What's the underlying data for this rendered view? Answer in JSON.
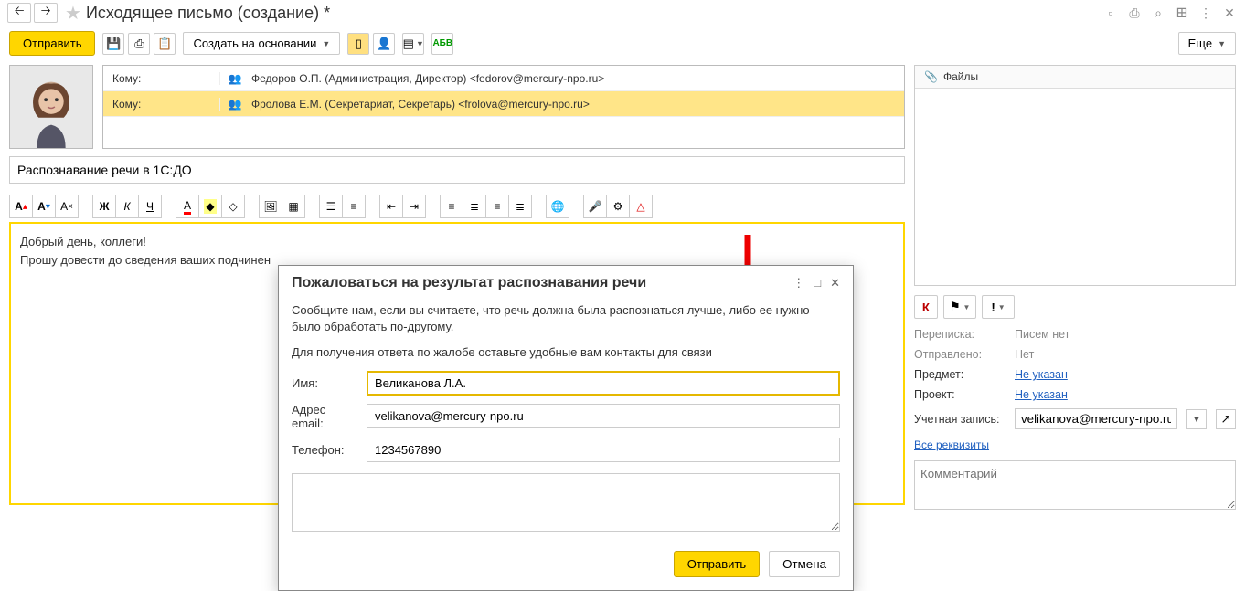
{
  "header": {
    "title": "Исходящее письмо (создание) *"
  },
  "toolbar": {
    "send": "Отправить",
    "create_based": "Создать на основании",
    "more": "Еще"
  },
  "recipients": {
    "label": "Кому:",
    "rows": [
      "Федоров О.П. (Администрация, Директор) <fedorov@mercury-npo.ru>",
      "Фролова Е.М. (Секретариат, Секретарь) <frolova@mercury-npo.ru>"
    ]
  },
  "subject": "Распознавание речи в 1С:ДО",
  "body": {
    "line1": "Добрый день, коллеги!",
    "line2": "Прошу довести до сведения ваших подчинен"
  },
  "files": {
    "title": "Файлы"
  },
  "meta": {
    "k_letter": "К",
    "thread_label": "Переписка:",
    "thread_val": "Писем нет",
    "sent_label": "Отправлено:",
    "sent_val": "Нет",
    "subject_label": "Предмет:",
    "subject_val": "Не указан",
    "project_label": "Проект:",
    "project_val": "Не указан",
    "account_label": "Учетная запись:",
    "account_val": "velikanova@mercury-npo.ru",
    "all_req": "Все реквизиты",
    "comment_ph": "Комментарий"
  },
  "dialog": {
    "title": "Пожаловаться на результат распознавания речи",
    "text1": "Сообщите нам, если вы считаете, что речь должна была распознаться лучше, либо ее нужно было обработать по-другому.",
    "text2": "Для получения ответа по жалобе оставьте удобные вам контакты для связи",
    "name_label": "Имя:",
    "name_val": "Великанова Л.А.",
    "email_label": "Адрес email:",
    "email_val": "velikanova@mercury-npo.ru",
    "phone_label": "Телефон:",
    "phone_val": "1234567890",
    "submit": "Отправить",
    "cancel": "Отмена"
  }
}
